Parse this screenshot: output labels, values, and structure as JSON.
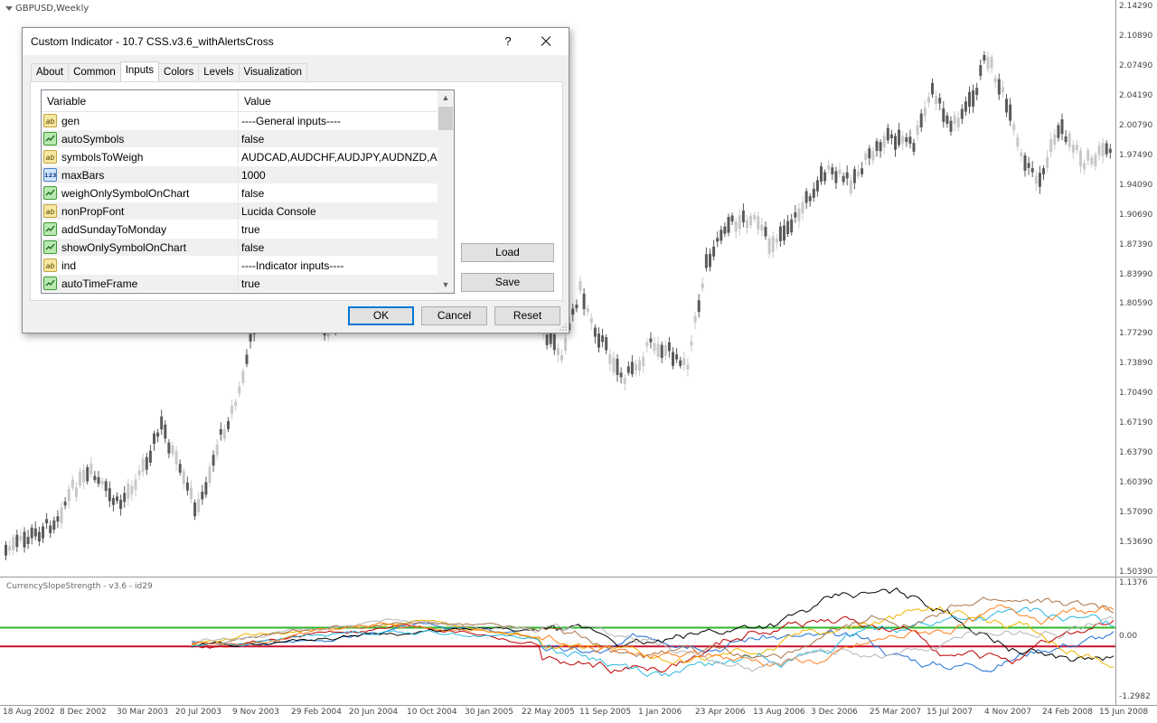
{
  "chart": {
    "symbol_title": "GBPUSD,Weekly",
    "price_labels": [
      "2.14290",
      "2.10890",
      "2.07490",
      "2.04190",
      "2.00790",
      "1.97490",
      "1.94090",
      "1.90690",
      "1.87390",
      "1.83990",
      "1.80590",
      "1.77290",
      "1.73890",
      "1.70490",
      "1.67190",
      "1.63790",
      "1.60390",
      "1.57090",
      "1.53690",
      "1.50390"
    ],
    "date_labels": [
      "18 Aug 2002",
      "8 Dec 2002",
      "30 Mar 2003",
      "20 Jul 2003",
      "9 Nov 2003",
      "29 Feb 2004",
      "20 Jun 2004",
      "10 Oct 2004",
      "30 Jan 2005",
      "22 May 2005",
      "11 Sep 2005",
      "1 Jan 2006",
      "23 Apr 2006",
      "13 Aug 2006",
      "3 Dec 2006",
      "25 Mar 2007",
      "15 Jul 2007",
      "4 Nov 2007",
      "24 Feb 2008",
      "15 Jun 2008"
    ],
    "price_range": [
      1.5039,
      2.1429
    ],
    "candle_color_up": "#c8c8c8",
    "candle_color_down": "#5a5a5a"
  },
  "indicator": {
    "title": "CurrencySlopeStrength - v3.6 - id29",
    "scale_labels": [
      "1.1376",
      "0.00",
      "-1.2982"
    ],
    "scale_range": [
      -1.2982,
      1.1376
    ],
    "upper_level": 0.2,
    "lower_level": -0.2,
    "upper_level_color": "#2db82d",
    "lower_level_color": "#c8102e",
    "line_colors": [
      "#1f6fd6",
      "#c00000",
      "#000000",
      "#f2b600",
      "#28b8e0",
      "#a9744a",
      "#ff7f1f",
      "#b5b5b5"
    ]
  },
  "dialog": {
    "title": "Custom Indicator - 10.7 CSS.v3.6_withAlertsCross",
    "help_label": "?",
    "tabs": [
      {
        "label": "About"
      },
      {
        "label": "Common"
      },
      {
        "label": "Inputs"
      },
      {
        "label": "Colors"
      },
      {
        "label": "Levels"
      },
      {
        "label": "Visualization"
      }
    ],
    "active_tab": "Inputs",
    "grid": {
      "col_variable": "Variable",
      "col_value": "Value",
      "rows": [
        {
          "type": "ab",
          "icon": "text-type-icon",
          "variable": "gen",
          "value": "----General inputs----"
        },
        {
          "type": "bool",
          "icon": "bool-type-icon",
          "variable": "autoSymbols",
          "value": "false"
        },
        {
          "type": "ab",
          "icon": "text-type-icon",
          "variable": "symbolsToWeigh",
          "value": "AUDCAD,AUDCHF,AUDJPY,AUDNZD,A..."
        },
        {
          "type": "num",
          "icon": "number-type-icon",
          "variable": "maxBars",
          "value": "1000"
        },
        {
          "type": "bool",
          "icon": "bool-type-icon",
          "variable": "weighOnlySymbolOnChart",
          "value": "false"
        },
        {
          "type": "ab",
          "icon": "text-type-icon",
          "variable": "nonPropFont",
          "value": "Lucida Console"
        },
        {
          "type": "bool",
          "icon": "bool-type-icon",
          "variable": "addSundayToMonday",
          "value": "true"
        },
        {
          "type": "bool",
          "icon": "bool-type-icon",
          "variable": "showOnlySymbolOnChart",
          "value": "false"
        },
        {
          "type": "ab",
          "icon": "text-type-icon",
          "variable": "ind",
          "value": "----Indicator inputs----"
        },
        {
          "type": "bool",
          "icon": "bool-type-icon",
          "variable": "autoTimeFrame",
          "value": "true"
        }
      ]
    },
    "buttons": {
      "load": "Load",
      "save": "Save",
      "ok": "OK",
      "cancel": "Cancel",
      "reset": "Reset"
    }
  }
}
